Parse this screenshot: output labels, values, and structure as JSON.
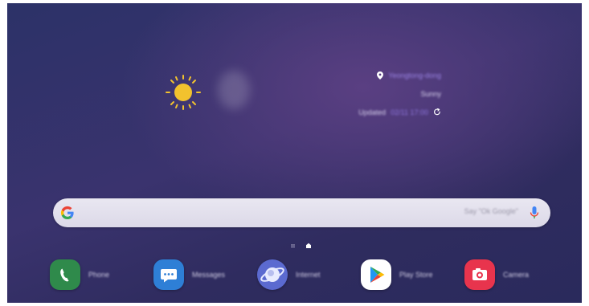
{
  "weather": {
    "location": "Yeongtong-dong",
    "condition": "Sunny",
    "updated_label": "Updated",
    "updated_time": "02/11 17:00"
  },
  "search": {
    "placeholder": "Say \"Ok Google\""
  },
  "dock": {
    "apps": [
      {
        "label": "Phone",
        "icon": "phone-icon",
        "color": "#2f8a4b"
      },
      {
        "label": "Messages",
        "icon": "messages-icon",
        "color": "#2e7fd6"
      },
      {
        "label": "Internet",
        "icon": "internet-icon",
        "color": "#5b6ad0"
      },
      {
        "label": "Play Store",
        "icon": "play-store-icon",
        "color": "#ffffff"
      },
      {
        "label": "Camera",
        "icon": "camera-icon",
        "color": "#e8344d"
      }
    ]
  },
  "colors": {
    "sun": "#f2c22e",
    "accent_text": "#9b84e6"
  }
}
